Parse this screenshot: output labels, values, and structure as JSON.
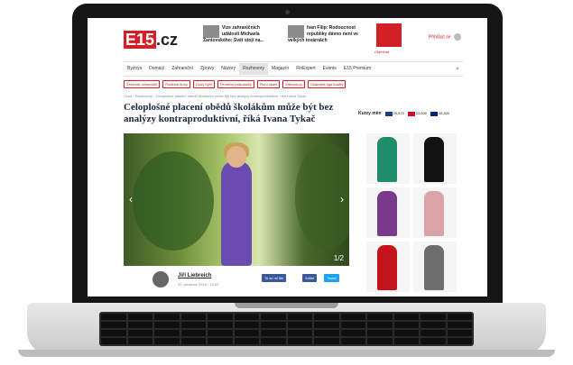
{
  "site": {
    "logo_main": "E15",
    "logo_suffix": ".cz",
    "login_label": "Přihlásit se"
  },
  "teasers": [
    {
      "text": "Vize zahraničních událostí Michaela Žantovského: Svět stojí na..."
    },
    {
      "text": "Ivan Filip: Rodoucnost republiky dávno není ve velkých továrnách"
    }
  ],
  "promo": {
    "link_label": "Objednat"
  },
  "nav": {
    "items": [
      "Byznys",
      "Domácí",
      "Zahraniční",
      "Zprávy",
      "Názory",
      "Rozhovory",
      "Magazín",
      "FinExpert",
      "Events",
      "E15 Premium"
    ],
    "active_index": 5
  },
  "tags": [
    "Žebříček miliardářů",
    "Rodinné firmy",
    "Ceny bytů",
    "Finanční kalkulačky",
    "Pivní skaut",
    "Mikroekop",
    "Okamžitě liga kvality"
  ],
  "breadcrumb": "Úvod › Rozhovory › Celoplošné placení obědů školákům může být bez analýzy kontraproduktivní, říká Ivana Tykač",
  "article": {
    "headline": "Celoplošné placení obědů školákům může být bez analýzy kontraproduktivní, říká Ivana Tykač",
    "gallery_counter": "1/2",
    "author": "Jiří Liebreich",
    "date": "20. prosince 2018 · 10:00",
    "share_fb": "To se mi líbí",
    "share_fb2": "Sdílet",
    "share_tw": "Tweet"
  },
  "rates": {
    "label": "Kurzy měn",
    "items": [
      {
        "value": "25,570",
        "flag_color": "#1c3b8f"
      },
      {
        "value": "22,600",
        "flag_color": "#c8102e"
      },
      {
        "value": "28,520",
        "flag_color": "#00247d"
      }
    ]
  },
  "ads": [
    {
      "color": "#1f8c6a"
    },
    {
      "color": "#121212"
    },
    {
      "color": "#7a3a8c"
    },
    {
      "color": "#d9a3a8"
    },
    {
      "color": "#c4151c"
    },
    {
      "color": "#6e6e6e"
    }
  ]
}
